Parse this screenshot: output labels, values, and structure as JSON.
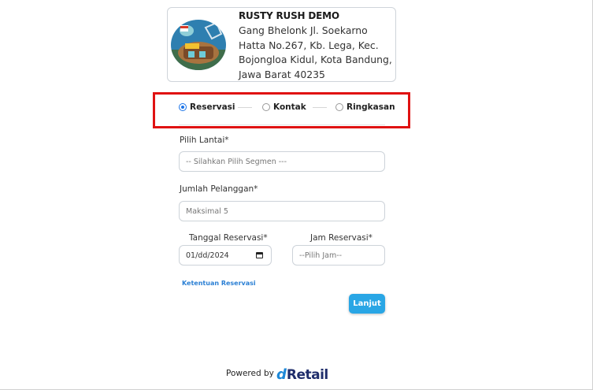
{
  "store": {
    "name": "RUSTY RUSH DEMO",
    "address": "Gang Bhelonk Jl. Soekarno Hatta No.267, Kb. Lega, Kec. Bojongloa Kidul, Kota Bandung, Jawa Barat 40235"
  },
  "steps": [
    {
      "label": "Reservasi",
      "active": true
    },
    {
      "label": "Kontak",
      "active": false
    },
    {
      "label": "Ringkasan",
      "active": false
    }
  ],
  "form": {
    "floor_label": "Pilih Lantai*",
    "floor_placeholder": "-- Silahkan Pilih Segmen ---",
    "guests_label": "Jumlah Pelanggan*",
    "guests_placeholder": "Maksimal 5",
    "date_label": "Tanggal Reservasi*",
    "date_value": "01/dd/2024",
    "time_label": "Jam Reservasi*",
    "time_placeholder": "--Pilih Jam--",
    "terms_link": "Ketentuan Reservasi",
    "next_button": "Lanjut"
  },
  "footer": {
    "powered_by": "Powered by",
    "brand_d": "d",
    "brand_rest": "Retail"
  },
  "colors": {
    "accent": "#29a6e5",
    "highlight": "#e01212",
    "link": "#2a7fd4"
  },
  "icons": [
    "store-logo",
    "calendar-icon",
    "radio-icon"
  ]
}
